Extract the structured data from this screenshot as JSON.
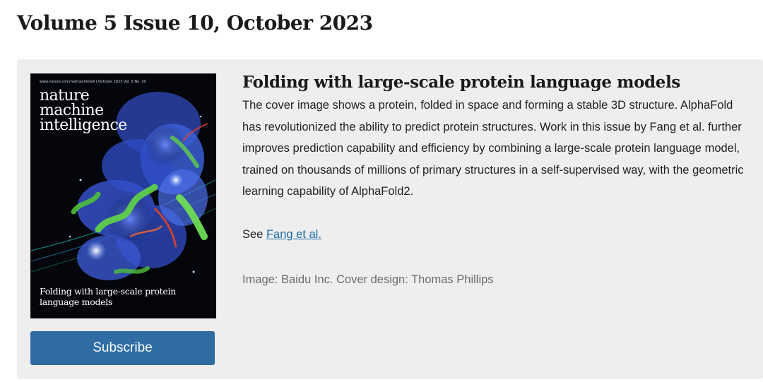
{
  "issue": {
    "title": "Volume 5 Issue 10, October 2023"
  },
  "cover": {
    "meta_line": "www.nature.com/natmachintell | October 2023 Vol. 5 No. 10",
    "journal_name": "nature machine intelligence",
    "caption": "Folding with large-scale protein language models",
    "colors": {
      "background": "#05070c",
      "protein_blue": "#3b5fd6",
      "helix_green": "#5fcf4a",
      "accent_red": "#e0442c"
    }
  },
  "subscribe": {
    "label": "Subscribe",
    "color": "#2e6ca3"
  },
  "article": {
    "title": "Folding with large-scale protein language models",
    "body": "The cover image shows a protein, folded in space and forming a stable 3D structure. AlphaFold has revolutionized the ability to predict protein structures. Work in this issue by Fang et al. further improves prediction capability and efficiency by combining a large-scale protein language model, trained on thousands of millions of primary structures in a self-supervised way, with the geometric learning capability of AlphaFold2.",
    "see_prefix": "See ",
    "see_link": "Fang et al.",
    "credits": "Image: Baidu Inc. Cover design: Thomas Phillips"
  }
}
